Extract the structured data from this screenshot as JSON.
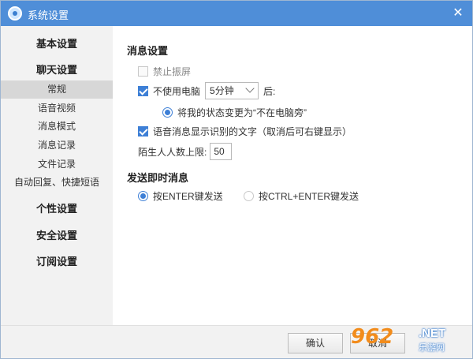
{
  "window": {
    "title": "系统设置",
    "close_glyph": "✕"
  },
  "sidebar": {
    "groups": [
      {
        "label": "基本设置"
      },
      {
        "label": "聊天设置"
      },
      {
        "label": "个性设置"
      },
      {
        "label": "安全设置"
      },
      {
        "label": "订阅设置"
      }
    ],
    "chat_items": [
      {
        "label": "常规",
        "active": true
      },
      {
        "label": "语音视频"
      },
      {
        "label": "消息模式"
      },
      {
        "label": "消息记录"
      },
      {
        "label": "文件记录"
      },
      {
        "label": "自动回复、快捷短语"
      }
    ]
  },
  "content": {
    "message_section_title": "消息设置",
    "no_disturb": {
      "label": "禁止振屏",
      "checked": false,
      "disabled": true
    },
    "idle": {
      "label": "不使用电脑",
      "checked": true,
      "select_value": "5分钟",
      "suffix": "后:"
    },
    "away_status": {
      "label": "将我的状态变更为“不在电脑旁”",
      "checked": true
    },
    "voice_text": {
      "label": "语音消息显示识别的文字（取消后可右键显示）",
      "checked": true
    },
    "stranger_limit": {
      "label": "陌生人人数上限:",
      "value": "50"
    },
    "send_section_title": "发送即时消息",
    "send_enter": {
      "label": "按ENTER键发送",
      "checked": true
    },
    "send_ctrl_enter": {
      "label": "按CTRL+ENTER键发送",
      "checked": false
    }
  },
  "footer": {
    "confirm_label": "确认",
    "cancel_label": "取消"
  },
  "watermark": {
    "number": "962",
    "domain": ".NET",
    "site": "乐游网"
  },
  "colors": {
    "titlebar": "#4f8ed8",
    "accent": "#3d7fd6",
    "active_nav": "#d7d7d7"
  }
}
